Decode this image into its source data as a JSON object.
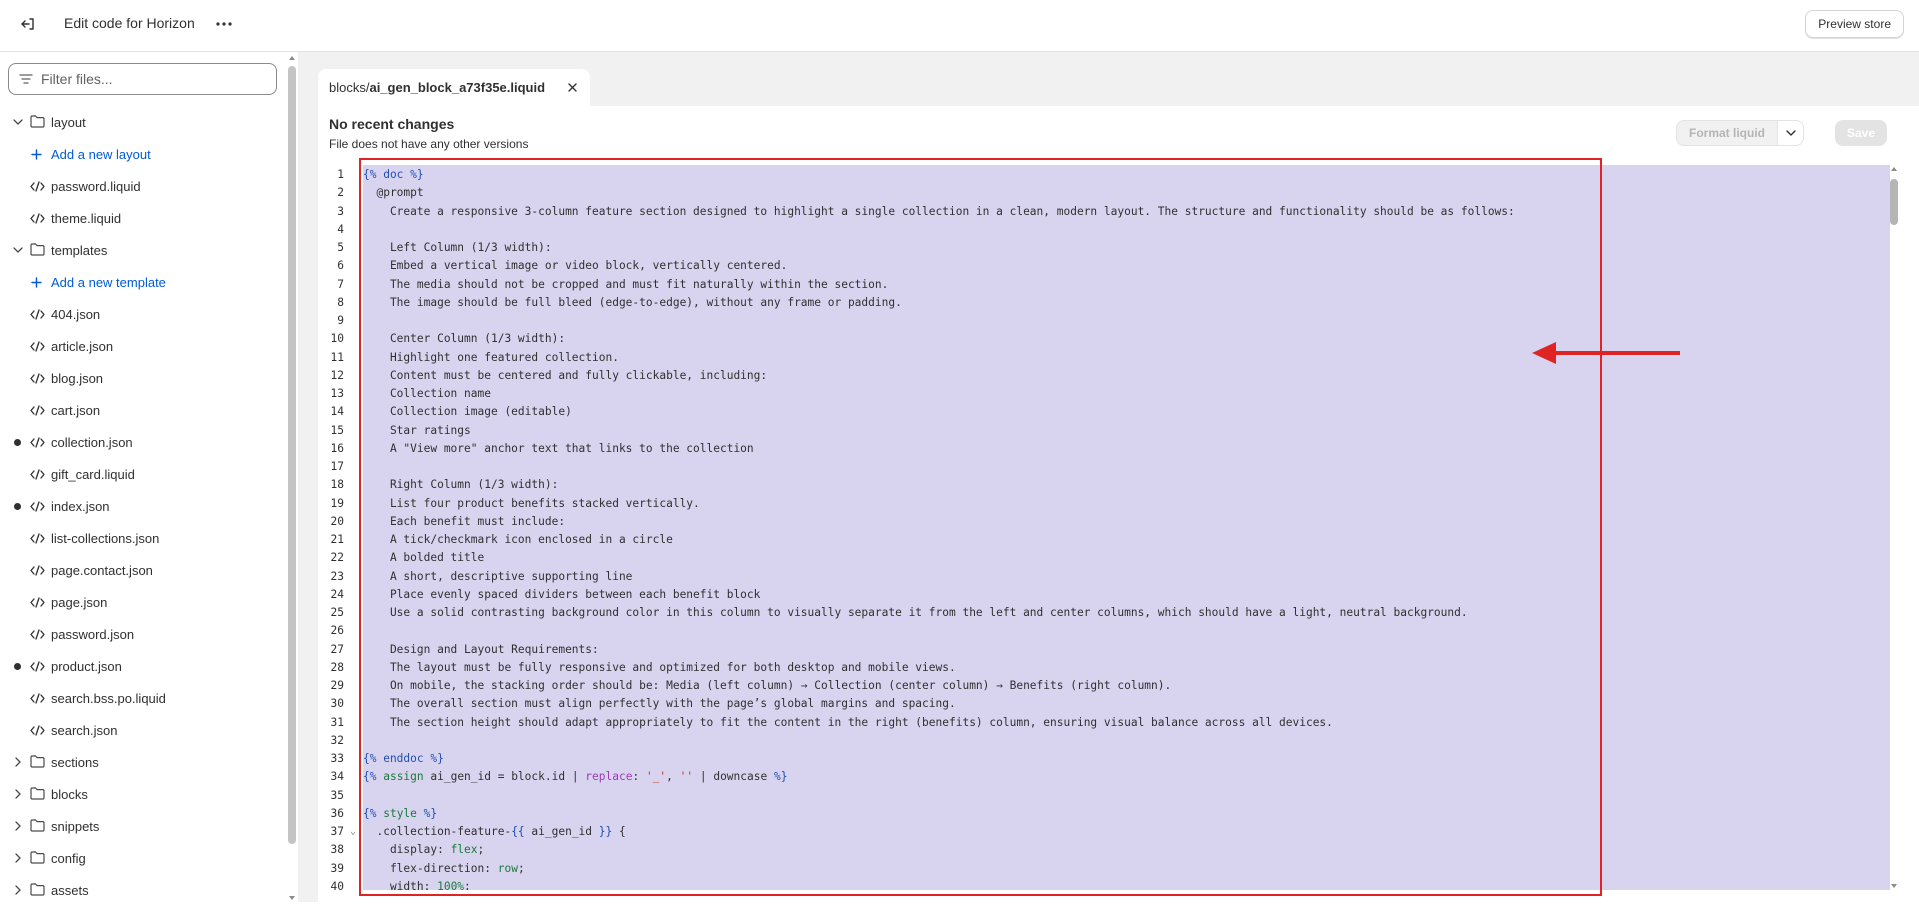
{
  "header": {
    "title": "Edit code for Horizon",
    "preview_label": "Preview store"
  },
  "sidebar": {
    "filter_placeholder": "Filter files...",
    "items": [
      {
        "type": "folder",
        "label": "layout",
        "expanded": true
      },
      {
        "type": "add",
        "label": "Add a new layout"
      },
      {
        "type": "file",
        "label": "password.liquid"
      },
      {
        "type": "file",
        "label": "theme.liquid"
      },
      {
        "type": "folder",
        "label": "templates",
        "expanded": true
      },
      {
        "type": "add",
        "label": "Add a new template"
      },
      {
        "type": "file",
        "label": "404.json"
      },
      {
        "type": "file",
        "label": "article.json"
      },
      {
        "type": "file",
        "label": "blog.json"
      },
      {
        "type": "file",
        "label": "cart.json"
      },
      {
        "type": "file",
        "label": "collection.json",
        "modified": true
      },
      {
        "type": "file",
        "label": "gift_card.liquid"
      },
      {
        "type": "file",
        "label": "index.json",
        "modified": true
      },
      {
        "type": "file",
        "label": "list-collections.json"
      },
      {
        "type": "file",
        "label": "page.contact.json"
      },
      {
        "type": "file",
        "label": "page.json"
      },
      {
        "type": "file",
        "label": "password.json"
      },
      {
        "type": "file",
        "label": "product.json",
        "modified": true
      },
      {
        "type": "file",
        "label": "search.bss.po.liquid"
      },
      {
        "type": "file",
        "label": "search.json"
      },
      {
        "type": "folder",
        "label": "sections",
        "expanded": false
      },
      {
        "type": "folder",
        "label": "blocks",
        "expanded": false
      },
      {
        "type": "folder",
        "label": "snippets",
        "expanded": false
      },
      {
        "type": "folder",
        "label": "config",
        "expanded": false
      },
      {
        "type": "folder",
        "label": "assets",
        "expanded": false
      }
    ]
  },
  "tab": {
    "dir": "blocks/",
    "file": "ai_gen_block_a73f35e.liquid"
  },
  "status": {
    "title": "No recent changes",
    "subtitle": "File does not have any other versions"
  },
  "toolbar": {
    "format_label": "Format liquid",
    "save_label": "Save"
  },
  "code_lines": [
    {
      "n": "1",
      "segs": [
        [
          "tag",
          "{% doc %}"
        ]
      ]
    },
    {
      "n": "2",
      "segs": [
        [
          "t",
          "  @prompt"
        ]
      ]
    },
    {
      "n": "3",
      "segs": [
        [
          "t",
          "    Create a responsive 3-column feature section designed to highlight a single collection in a clean, modern layout. The structure and functionality should be as follows:"
        ]
      ]
    },
    {
      "n": "4",
      "segs": [
        [
          "t",
          ""
        ]
      ]
    },
    {
      "n": "5",
      "segs": [
        [
          "t",
          "    Left Column (1/3 width):"
        ]
      ]
    },
    {
      "n": "6",
      "segs": [
        [
          "t",
          "    Embed a vertical image or video block, vertically centered."
        ]
      ]
    },
    {
      "n": "7",
      "segs": [
        [
          "t",
          "    The media should not be cropped and must fit naturally within the section."
        ]
      ]
    },
    {
      "n": "8",
      "segs": [
        [
          "t",
          "    The image should be full bleed (edge-to-edge), without any frame or padding."
        ]
      ]
    },
    {
      "n": "9",
      "segs": [
        [
          "t",
          ""
        ]
      ]
    },
    {
      "n": "10",
      "segs": [
        [
          "t",
          "    Center Column (1/3 width):"
        ]
      ]
    },
    {
      "n": "11",
      "segs": [
        [
          "t",
          "    Highlight one featured collection."
        ]
      ]
    },
    {
      "n": "12",
      "segs": [
        [
          "t",
          "    Content must be centered and fully clickable, including:"
        ]
      ]
    },
    {
      "n": "13",
      "segs": [
        [
          "t",
          "    Collection name"
        ]
      ]
    },
    {
      "n": "14",
      "segs": [
        [
          "t",
          "    Collection image (editable)"
        ]
      ]
    },
    {
      "n": "15",
      "segs": [
        [
          "t",
          "    Star ratings"
        ]
      ]
    },
    {
      "n": "16",
      "segs": [
        [
          "t",
          "    A \"View more\" anchor text that links to the collection"
        ]
      ]
    },
    {
      "n": "17",
      "segs": [
        [
          "t",
          ""
        ]
      ]
    },
    {
      "n": "18",
      "segs": [
        [
          "t",
          "    Right Column (1/3 width):"
        ]
      ]
    },
    {
      "n": "19",
      "segs": [
        [
          "t",
          "    List four product benefits stacked vertically."
        ]
      ]
    },
    {
      "n": "20",
      "segs": [
        [
          "t",
          "    Each benefit must include:"
        ]
      ]
    },
    {
      "n": "21",
      "segs": [
        [
          "t",
          "    A tick/checkmark icon enclosed in a circle"
        ]
      ]
    },
    {
      "n": "22",
      "segs": [
        [
          "t",
          "    A bolded title"
        ]
      ]
    },
    {
      "n": "23",
      "segs": [
        [
          "t",
          "    A short, descriptive supporting line"
        ]
      ]
    },
    {
      "n": "24",
      "segs": [
        [
          "t",
          "    Place evenly spaced dividers between each benefit block"
        ]
      ]
    },
    {
      "n": "25",
      "segs": [
        [
          "t",
          "    Use a solid contrasting background color in this column to visually separate it from the left and center columns, which should have a light, neutral background."
        ]
      ]
    },
    {
      "n": "26",
      "segs": [
        [
          "t",
          ""
        ]
      ]
    },
    {
      "n": "27",
      "segs": [
        [
          "t",
          "    Design and Layout Requirements:"
        ]
      ]
    },
    {
      "n": "28",
      "segs": [
        [
          "t",
          "    The layout must be fully responsive and optimized for both desktop and mobile views."
        ]
      ]
    },
    {
      "n": "29",
      "segs": [
        [
          "t",
          "    On mobile, the stacking order should be: Media (left column) → Collection (center column) → Benefits (right column)."
        ]
      ]
    },
    {
      "n": "30",
      "segs": [
        [
          "t",
          "    The overall section must align perfectly with the page’s global margins and spacing."
        ]
      ]
    },
    {
      "n": "31",
      "segs": [
        [
          "t",
          "    The section height should adapt appropriately to fit the content in the right (benefits) column, ensuring visual balance across all devices."
        ]
      ]
    },
    {
      "n": "32",
      "segs": [
        [
          "t",
          ""
        ]
      ]
    },
    {
      "n": "33",
      "segs": [
        [
          "tag",
          "{% enddoc %}"
        ]
      ]
    },
    {
      "n": "34",
      "segs": [
        [
          "tag",
          "{% "
        ],
        [
          "kw",
          "assign"
        ],
        [
          "t",
          " ai_gen_id = block.id | "
        ],
        [
          "fn",
          "replace"
        ],
        [
          "t",
          ": "
        ],
        [
          "str",
          "'_'"
        ],
        [
          "t",
          ", "
        ],
        [
          "str",
          "''"
        ],
        [
          "t",
          " | downcase "
        ],
        [
          "tag",
          "%}"
        ]
      ]
    },
    {
      "n": "35",
      "segs": [
        [
          "t",
          ""
        ]
      ]
    },
    {
      "n": "36",
      "segs": [
        [
          "tag",
          "{% "
        ],
        [
          "kw",
          "style"
        ],
        [
          "tag",
          " %}"
        ]
      ]
    },
    {
      "n": "37",
      "fold": "⌄",
      "segs": [
        [
          "t",
          "  .collection-feature-"
        ],
        [
          "tag",
          "{{ "
        ],
        [
          "var",
          "ai_gen_id"
        ],
        [
          "tag",
          " }}"
        ],
        [
          "t",
          " {"
        ]
      ]
    },
    {
      "n": "38",
      "segs": [
        [
          "t",
          "    display: "
        ],
        [
          "kw",
          "flex"
        ],
        [
          "t",
          ";"
        ]
      ]
    },
    {
      "n": "39",
      "segs": [
        [
          "t",
          "    flex-direction: "
        ],
        [
          "kw",
          "row"
        ],
        [
          "t",
          ";"
        ]
      ]
    },
    {
      "n": "40",
      "segs": [
        [
          "t",
          "    width: "
        ],
        [
          "kw",
          "100%"
        ],
        [
          "t",
          ";"
        ]
      ]
    }
  ]
}
